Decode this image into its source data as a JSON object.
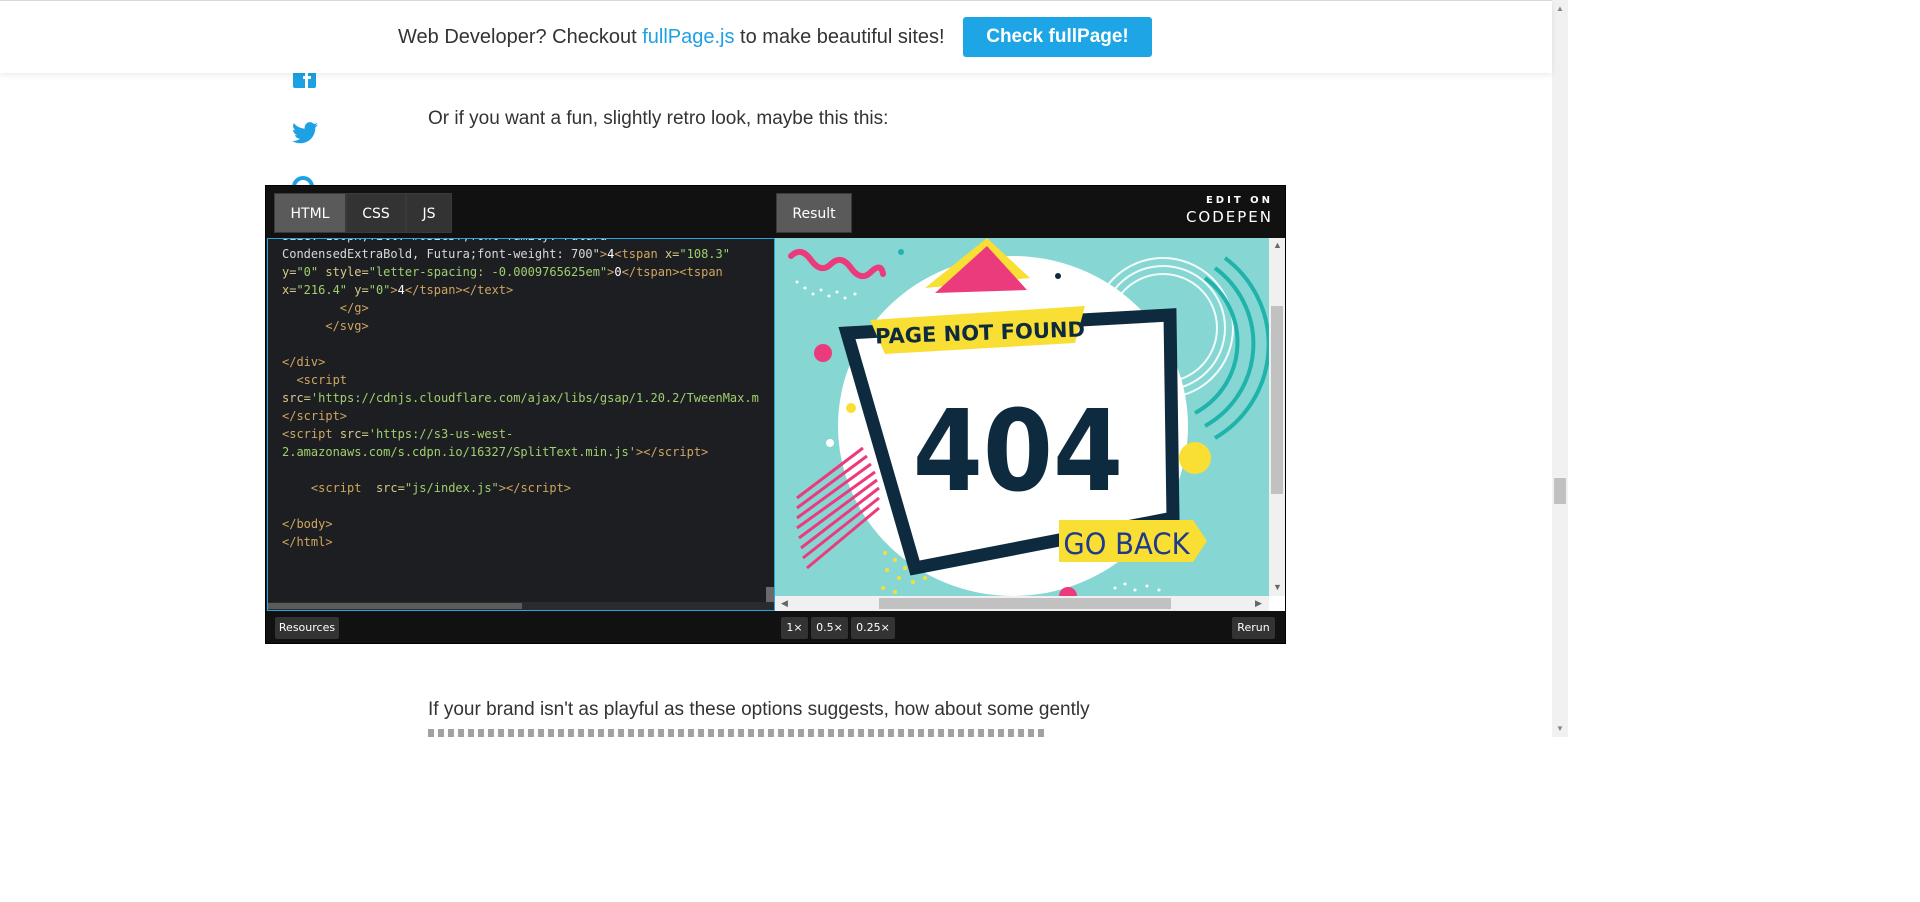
{
  "banner": {
    "text_before": "Web Developer? Checkout ",
    "link": "fullPage.js",
    "text_after": " to make beautiful sites!",
    "button": "Check fullPage!"
  },
  "article": {
    "para1": "Or if you want a fun, slightly retro look, maybe this this:",
    "para2": "If your brand isn't as playful as these options suggests, how about some gently"
  },
  "pen": {
    "tabs": [
      "HTML",
      "CSS",
      "JS"
    ],
    "result_tab": "Result",
    "logo_edit": "EDIT ON",
    "logo_brand": "CODEPEN",
    "resources": "Resources",
    "zoom_options": [
      "1×",
      "0.5×",
      "0.25×"
    ],
    "rerun": "Rerun"
  },
  "result": {
    "page_not_found": "PAGE NOT FOUND",
    "code_404": "404",
    "go_back": "GO BACK"
  },
  "colors": {
    "accent": "#1ea5e5",
    "teal": "#86d7d3",
    "navy": "#0e2a3e",
    "yellow": "#f9df34",
    "pink": "#ec3b7d"
  }
}
